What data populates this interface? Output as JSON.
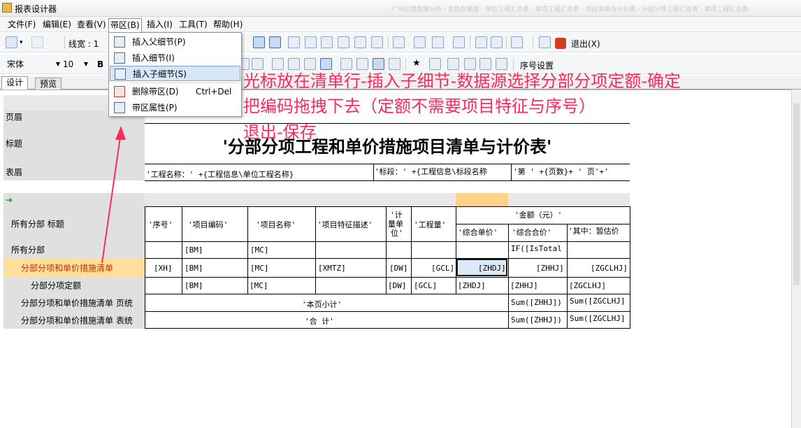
{
  "window": {
    "title": "报表设计器",
    "ghost_title": "广州运营数据分析 · 会员数据库 · 单位工程汇总表 · 单项工程汇总表 · 项目清单与计价表 · 分部分项工程汇总表 · 单项工程汇总表"
  },
  "menubar": {
    "items": [
      {
        "label": "文件(F)"
      },
      {
        "label": "编辑(E)"
      },
      {
        "label": "查看(V)"
      },
      {
        "label": "带区(B)"
      },
      {
        "label": "插入(I)"
      },
      {
        "label": "工具(T)"
      },
      {
        "label": "帮助(H)"
      }
    ]
  },
  "toolbar1": {
    "line_width_label": "线宽 : 1",
    "exit_label": "退出(X)"
  },
  "toolbar2": {
    "font_name": "宋体",
    "font_size": "10",
    "bold": "B",
    "seq_label": "序号设置"
  },
  "tabs": [
    {
      "label": "设计"
    },
    {
      "label": "预览"
    }
  ],
  "dropdown": {
    "items": [
      {
        "label": "插入父细节(P)",
        "shortcut": ""
      },
      {
        "label": "插入细节(I)",
        "shortcut": ""
      },
      {
        "label": "插入子细节(S)",
        "shortcut": ""
      },
      {
        "label": "删除带区(D)",
        "shortcut": "Ctrl+Del"
      },
      {
        "label": "带区属性(P)",
        "shortcut": ""
      }
    ]
  },
  "bands": [
    {
      "label": "页眉"
    },
    {
      "label": "标题"
    },
    {
      "label": "表眉"
    },
    {
      "label": ""
    },
    {
      "label": "所有分部 标题"
    },
    {
      "label": "所有分部"
    },
    {
      "label": "分部分项和单价措施清单"
    },
    {
      "label": "分部分项定额"
    },
    {
      "label": "分部分项和单价措施清单 页统"
    },
    {
      "label": "分部分项和单价措施清单 表统"
    }
  ],
  "report": {
    "title": "'分部分项工程和单价措施项目清单与计价表'",
    "header_project": "'工程名称：' +{工程信息\\单位工程名称}",
    "header_section": "'标段：' +{工程信息\\标段名称",
    "header_page": "'第 ' +{页数}+ ' 页'+'",
    "col_headers": {
      "seq": "'序号'",
      "code": "'项目编码'",
      "name": "'项目名称'",
      "feature": "'项目特征描述'",
      "unit_lines": [
        "'计",
        "量单",
        "位'"
      ],
      "qty": "'工程量'",
      "amount": "'金额（元）'",
      "unit_price": "'综合单价'",
      "total_price": "'综合合价'",
      "provisional": "'其中：暂估价"
    },
    "row_all": {
      "code": "[BM]",
      "name": "[MC]",
      "total": "IF([IsTotal"
    },
    "row_list": {
      "seq": "[XH]",
      "code": "[BM]",
      "name": "[MC]",
      "feature": "[XMTZ]",
      "unit": "[DW]",
      "qty": "[GCL]",
      "unit_price": "[ZHDJ]",
      "total_price": "[ZHHJ]",
      "provisional": "[ZGCLHJ]"
    },
    "row_quota": {
      "code": "[BM]",
      "name": "[MC]",
      "unit": "[DW]",
      "qty": "[GCL]",
      "unit_price": "[ZHDJ]",
      "total_price": "[ZHHJ]",
      "provisional": "[ZGCLHJ]"
    },
    "page_total": {
      "label": "'本页小计'",
      "total_price": "Sum([ZHHJ])",
      "provisional": "Sum([ZGCLHJ]"
    },
    "table_total": {
      "label": "'合    计'",
      "total_price": "Sum([ZHHJ])",
      "provisional": "Sum([ZGCLHJ]"
    }
  },
  "annotation": {
    "line1": "光标放在清单行-插入子细节-数据源选择分部分项定额-确定",
    "line2": "把编码拖拽下去（定额不需要项目特征与序号）",
    "line3": "退出-保存",
    "color": "#ff2a5c"
  }
}
